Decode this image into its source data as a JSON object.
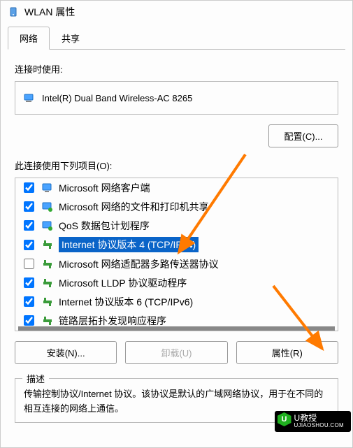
{
  "title": "WLAN 属性",
  "tabs": {
    "network": "网络",
    "sharing": "共享"
  },
  "connect_using_label": "连接时使用:",
  "adapter_name": "Intel(R) Dual Band Wireless-AC 8265",
  "configure_btn": "配置(C)...",
  "items_label": "此连接使用下列项目(O):",
  "items": [
    {
      "checked": true,
      "icon": "client",
      "label": "Microsoft 网络客户端"
    },
    {
      "checked": true,
      "icon": "service",
      "label": "Microsoft 网络的文件和打印机共享"
    },
    {
      "checked": true,
      "icon": "service",
      "label": "QoS 数据包计划程序"
    },
    {
      "checked": true,
      "icon": "proto",
      "label": "Internet 协议版本 4 (TCP/IPv4)",
      "selected": true
    },
    {
      "checked": false,
      "icon": "proto",
      "label": "Microsoft 网络适配器多路传送器协议"
    },
    {
      "checked": true,
      "icon": "proto",
      "label": "Microsoft LLDP 协议驱动程序"
    },
    {
      "checked": true,
      "icon": "proto",
      "label": "Internet 协议版本 6 (TCP/IPv6)"
    },
    {
      "checked": true,
      "icon": "proto",
      "label": "链路层拓扑发现响应程序"
    }
  ],
  "buttons": {
    "install": "安装(N)...",
    "uninstall": "卸载(U)",
    "properties": "属性(R)"
  },
  "desc": {
    "title": "描述",
    "text": "传输控制协议/Internet 协议。该协议是默认的广域网络协议，用于在不同的相互连接的网络上通信。"
  },
  "watermark": {
    "brand": "U教授",
    "url": "UJIAOSHOU.COM"
  }
}
